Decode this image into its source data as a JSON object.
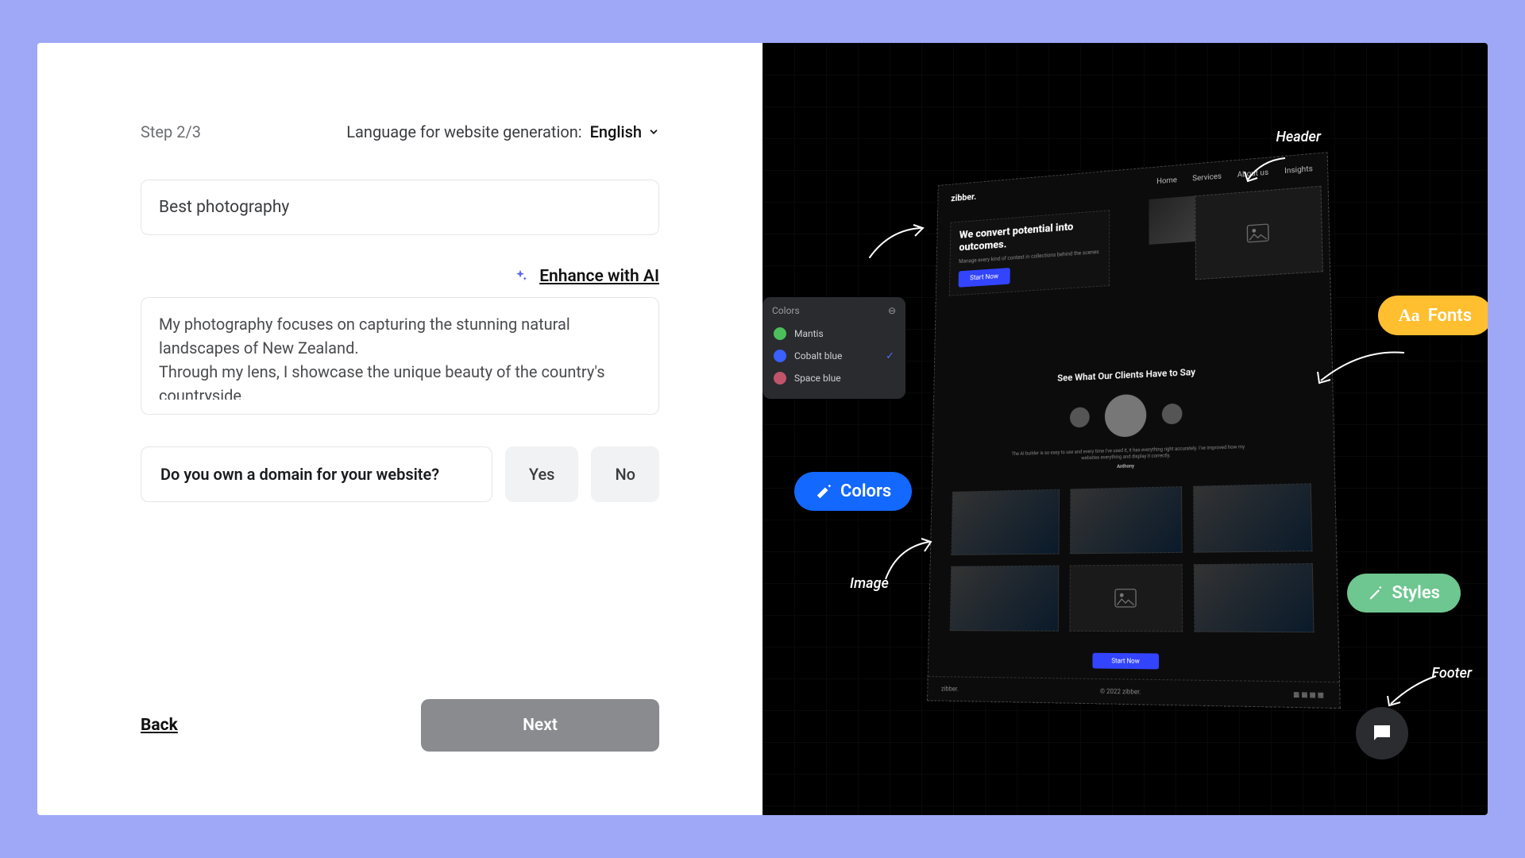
{
  "step_label": "Step 2/3",
  "language": {
    "label": "Language for website generation:",
    "value": "English"
  },
  "name_input": {
    "value": "Best photography"
  },
  "enhance_label": "Enhance with AI",
  "description": "My photography focuses on capturing the stunning natural landscapes of New Zealand.\nThrough my lens, I showcase the unique beauty of the country's countryside.\nMy photos highlight the intricate details of the scenery, from",
  "domain": {
    "question": "Do you own a domain for your website?",
    "yes": "Yes",
    "no": "No"
  },
  "nav": {
    "back": "Back",
    "next": "Next"
  },
  "preview": {
    "logo": "zibber.",
    "menu": [
      "Home",
      "Services",
      "About us",
      "Insights"
    ],
    "hero_title": "We convert potential into outcomes.",
    "hero_sub": "Manage every kind of contest in collections behind the scenes",
    "cta": "Start Now",
    "testimonials_heading": "See What Our Clients Have to Say",
    "testimonials_body": "The AI builder is so easy to use and every time I've used it, it has everything right accurately. I've improved how my websites everything and display it correctly.",
    "testimonials_author": "Anthony",
    "footer_copy": "© 2022 zibber."
  },
  "palette": {
    "title": "Colors",
    "items": [
      {
        "name": "Mantis",
        "hex": "#4bbf5b",
        "selected": false
      },
      {
        "name": "Cobalt blue",
        "hex": "#3a60ff",
        "selected": true
      },
      {
        "name": "Space blue",
        "hex": "#c0556a",
        "selected": false
      }
    ]
  },
  "badges": {
    "colors": "Colors",
    "fonts": "Fonts",
    "styles": "Styles"
  },
  "annotations": {
    "header": "Header",
    "footer": "Footer",
    "image": "Image"
  }
}
